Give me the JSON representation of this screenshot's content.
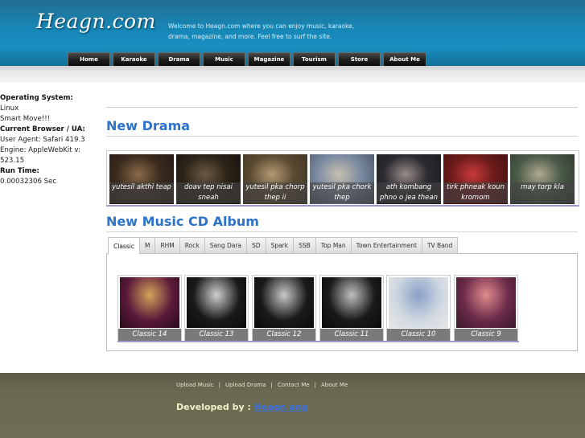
{
  "header": {
    "logo_text": "Heagn.com",
    "welcome_text": "Welcome to Heagn.com where you can enjoy music, karaoke, drama, magazine, and more. Feel free to surf the site."
  },
  "nav": [
    {
      "label": "Home"
    },
    {
      "label": "Karaoke"
    },
    {
      "label": "Drama"
    },
    {
      "label": "Music"
    },
    {
      "label": "Magazine"
    },
    {
      "label": "Tourism"
    },
    {
      "label": "Store"
    },
    {
      "label": "About Me"
    }
  ],
  "sidebar": {
    "os_heading": "Operating System:",
    "os_value1": "Linux",
    "os_value2": "Smart Move!!!",
    "browser_heading": "Current Browser / UA:",
    "user_agent": "User Agent: Safari 419.3",
    "engine": "Engine: AppleWebKit v: 523.15",
    "runtime_heading": "Run Time:",
    "runtime_value": "0.00032306 Sec"
  },
  "drama": {
    "title": "New Drama",
    "items": [
      {
        "caption": "yutesil akthi teap",
        "colors": [
          "#3a2a1e",
          "#8a6a48",
          "#1e1410"
        ]
      },
      {
        "caption": "doav tep nisai sneah",
        "colors": [
          "#2b2218",
          "#6b5a44",
          "#151008"
        ]
      },
      {
        "caption": "yutesil pka chorp thep ii",
        "colors": [
          "#5a4a32",
          "#b59a72",
          "#3a2e20"
        ]
      },
      {
        "caption": "yutesil pka chork thep",
        "colors": [
          "#7a8aa0",
          "#c8c0b0",
          "#40485a"
        ]
      },
      {
        "caption": "ath kombang phno o jea thean",
        "colors": [
          "#2a2a30",
          "#9a8a88",
          "#18181c"
        ]
      },
      {
        "caption": "tirk phneak koun kromom",
        "colors": [
          "#6a1a1a",
          "#c83a3a",
          "#3a0e0e"
        ]
      },
      {
        "caption": "may torp kla",
        "colors": [
          "#4a5a48",
          "#b0a890",
          "#2a3028"
        ]
      }
    ]
  },
  "music": {
    "title": "New Music CD Album",
    "tabs": [
      {
        "label": "Classic",
        "active": true
      },
      {
        "label": "M"
      },
      {
        "label": "RHM"
      },
      {
        "label": "Rock"
      },
      {
        "label": "Sang Dara"
      },
      {
        "label": "SD"
      },
      {
        "label": "Spark"
      },
      {
        "label": "SSB"
      },
      {
        "label": "Top Man"
      },
      {
        "label": "Town Entertainment"
      },
      {
        "label": "TV Band"
      }
    ],
    "albums": [
      {
        "caption": "Classic 14",
        "colors": [
          "#5a1a3a",
          "#d4a25a",
          "#2a0a1a"
        ]
      },
      {
        "caption": "Classic 13",
        "colors": [
          "#1a1a1a",
          "#cfcfcf",
          "#0a0a0a"
        ]
      },
      {
        "caption": "Classic 12",
        "colors": [
          "#1a1a1a",
          "#c8c8c8",
          "#0a0a0a"
        ]
      },
      {
        "caption": "Classic 11",
        "colors": [
          "#1a1a1a",
          "#c0c0c0",
          "#0a0a0a"
        ]
      },
      {
        "caption": "Classic 10",
        "colors": [
          "#cfd8e0",
          "#8aa0c8",
          "#e8e8e8"
        ]
      },
      {
        "caption": "Classic 9",
        "colors": [
          "#6a2a4a",
          "#e08a8a",
          "#3a1a2a"
        ]
      }
    ]
  },
  "footer": {
    "links": [
      {
        "label": "Upload Music"
      },
      {
        "label": "Upload Drama"
      },
      {
        "label": "Contact Me"
      },
      {
        "label": "About Me"
      }
    ],
    "separator": "|",
    "dev_label": "Developed by :",
    "dev_name": "Heagn ang"
  },
  "colors": {
    "accent": "#2c73c9",
    "header": "#1585b5",
    "footer": "#6a6a51"
  }
}
